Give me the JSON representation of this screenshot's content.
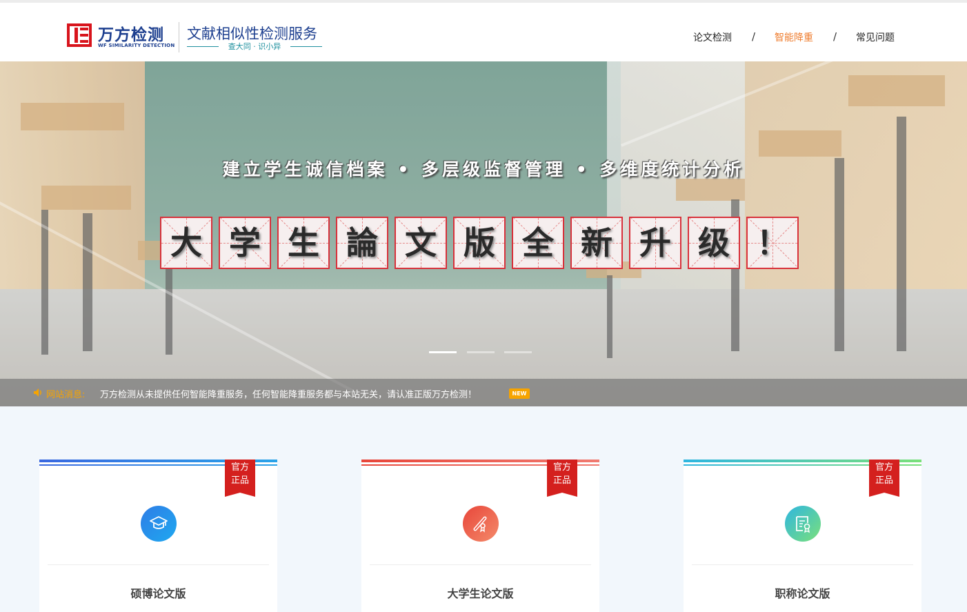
{
  "header": {
    "logo_cn": "万方检测",
    "logo_en": "WF SIMILARITY DETECTION",
    "service_title": "文献相似性检测服务",
    "service_subtitle": "查大同 · 识小异",
    "nav": [
      {
        "label": "论文检测",
        "active": false
      },
      {
        "label": "智能降重",
        "active": true
      },
      {
        "label": "常见问题",
        "active": false
      }
    ],
    "nav_separator": "/",
    "brand_color": "#1d3f8f",
    "accent_color": "#ef7d2f"
  },
  "banner": {
    "slogan": "建立学生诚信档案 • 多层级监督管理 • 多维度统计分析",
    "tiles": [
      "大",
      "学",
      "生",
      "論",
      "文",
      "版",
      "全",
      "新",
      "升",
      "级",
      "！"
    ],
    "slide_count": 3,
    "active_slide": 1
  },
  "notice": {
    "icon": "speaker-icon",
    "label": "网站消息:",
    "text": "万方检测从未提供任何智能降重服务，任何智能降重服务都与本站无关，请认准正版万方检测！",
    "badge": "NEW"
  },
  "cards": [
    {
      "title": "硕博论文版",
      "badge": "官方\n正品",
      "icon": "graduation-cap-icon",
      "stripe_from": "#3a68e0",
      "stripe_to": "#2aa3e8",
      "icon_from": "#2f7de6",
      "icon_to": "#1ea8f0"
    },
    {
      "title": "大学生论文版",
      "badge": "官方\n正品",
      "icon": "diploma-scroll-icon",
      "stripe_from": "#e8463a",
      "stripe_to": "#f07a70",
      "icon_from": "#e8463a",
      "icon_to": "#f48a6a"
    },
    {
      "title": "职称论文版",
      "badge": "官方\n正品",
      "icon": "certificate-icon",
      "stripe_from": "#2fb6e0",
      "stripe_to": "#7ae07a",
      "icon_from": "#2fb6e0",
      "icon_to": "#7ae07a"
    }
  ]
}
